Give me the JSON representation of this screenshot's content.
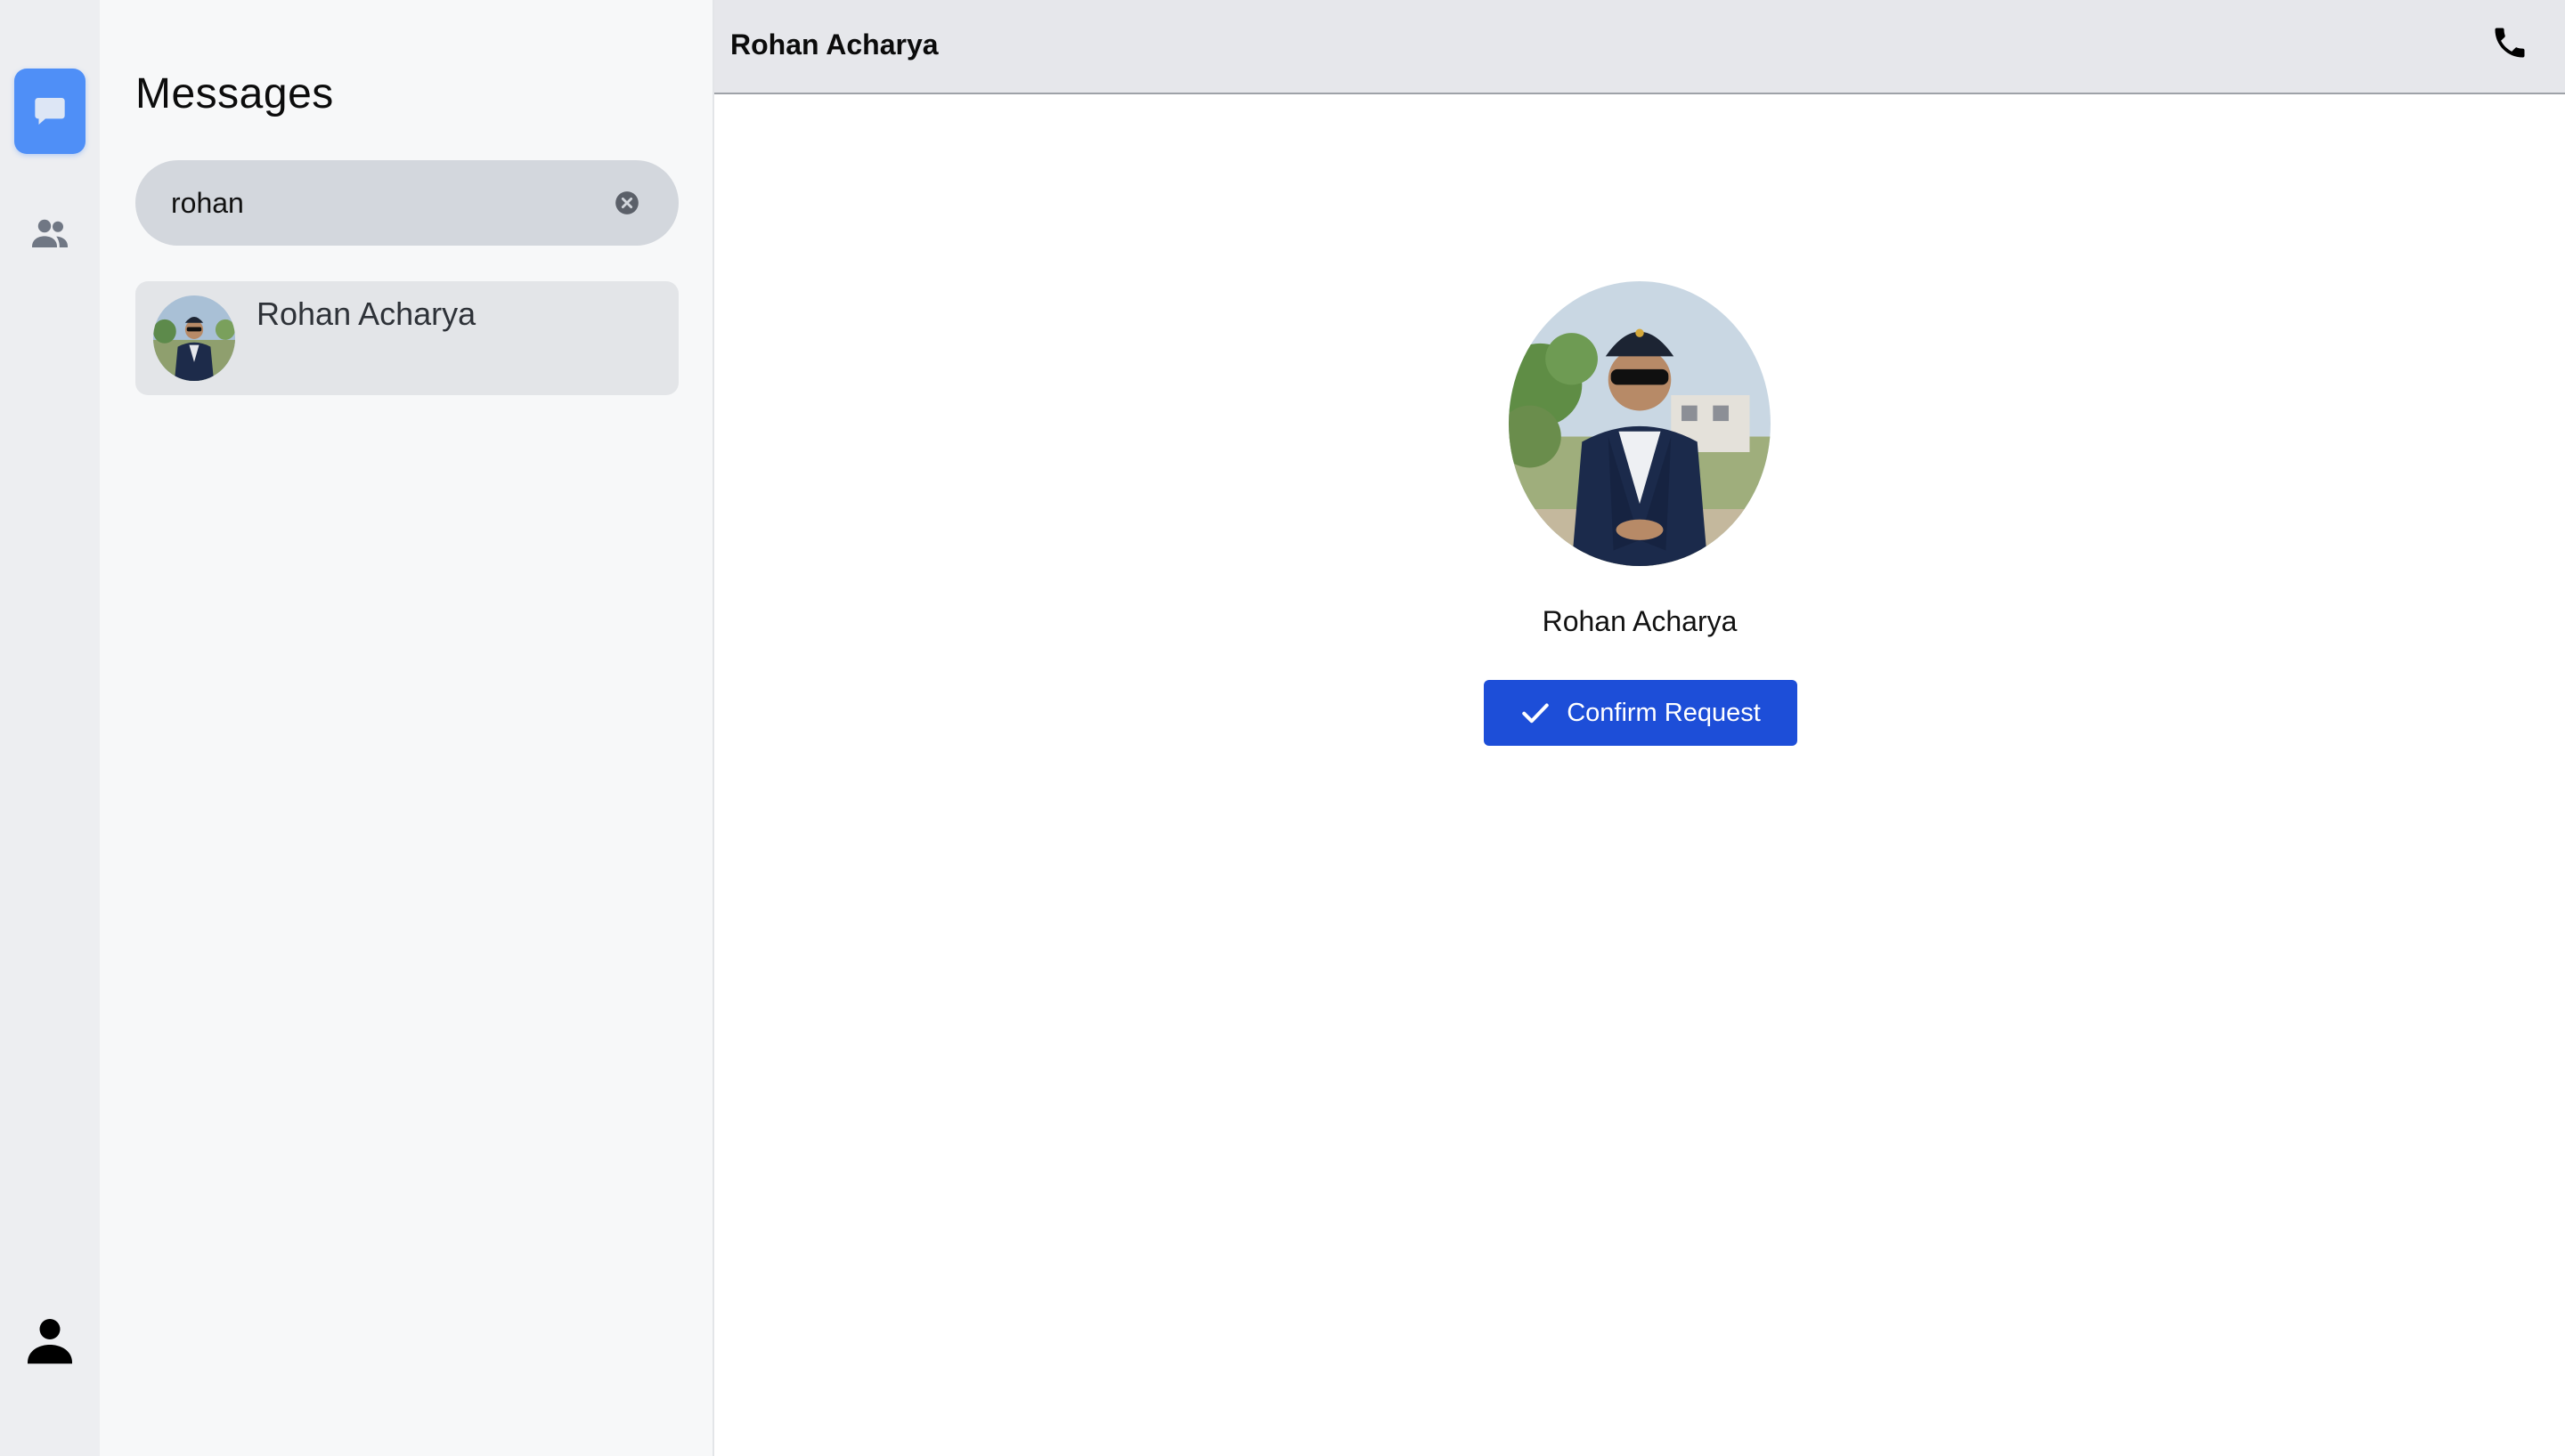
{
  "app": {
    "accent_color": "#1d4ed8",
    "active_rail_color": "#4f8ff7"
  },
  "rail": {
    "items": [
      {
        "id": "chats",
        "icon": "chat-bubble-icon",
        "active": true
      },
      {
        "id": "people",
        "icon": "people-icon",
        "active": false
      },
      {
        "id": "profile",
        "icon": "person-icon",
        "active": false
      }
    ]
  },
  "sidebar": {
    "title": "Messages",
    "search": {
      "value": "rohan",
      "clear_icon": "clear-circle-icon"
    },
    "results": [
      {
        "name": "Rohan Acharya",
        "avatar": "avatar-photo"
      }
    ]
  },
  "chat": {
    "header": {
      "name": "Rohan Acharya",
      "call_icon": "phone-icon"
    },
    "profile": {
      "name": "Rohan Acharya",
      "avatar": "avatar-photo"
    },
    "confirm_button": {
      "label": "Confirm Request",
      "icon": "checkmark-icon"
    }
  }
}
